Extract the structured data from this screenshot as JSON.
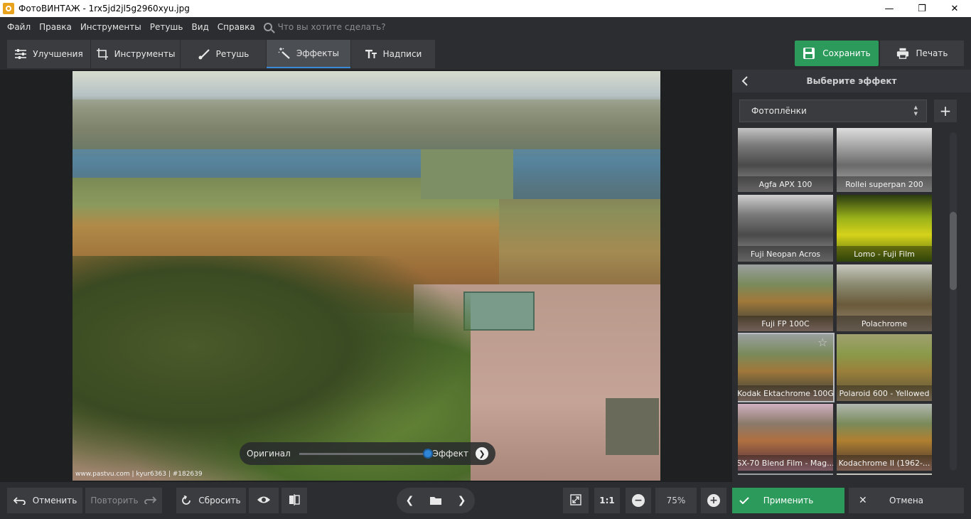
{
  "window": {
    "title": "ФотоВИНТАЖ - 1rx5jd2jl5g2960xyu.jpg",
    "minimize": "—",
    "maximize": "❐",
    "close": "✕"
  },
  "menu": {
    "items": [
      "Файл",
      "Правка",
      "Инструменты",
      "Ретушь",
      "Вид",
      "Справка"
    ],
    "search_placeholder": "Что вы хотите сделать?"
  },
  "tabs": [
    {
      "label": "Улучшения",
      "icon": "sliders-icon"
    },
    {
      "label": "Инструменты",
      "icon": "crop-icon"
    },
    {
      "label": "Ретушь",
      "icon": "brush-icon"
    },
    {
      "label": "Эффекты",
      "icon": "magic-wand-icon",
      "active": true
    },
    {
      "label": "Надписи",
      "icon": "text-icon"
    }
  ],
  "toolbar": {
    "save_label": "Сохранить",
    "print_label": "Печать"
  },
  "photo": {
    "credit": "www.pastvu.com | kyur6363 | #182639"
  },
  "compare": {
    "original_label": "Оригинал",
    "effect_label": "Эффект",
    "arrow": "❯"
  },
  "panel": {
    "title": "Выберите эффект",
    "category": "Фотоплёнки",
    "add": "+",
    "effects": [
      {
        "label": "Agfa APX 100",
        "style": "bw"
      },
      {
        "label": "Rollei superpan 200",
        "style": "bw-light"
      },
      {
        "label": "Fuji Neopan Acros",
        "style": "bw"
      },
      {
        "label": "Lomo - Fuji Film",
        "style": "lomo"
      },
      {
        "label": "Fuji FP 100C",
        "style": "warm"
      },
      {
        "label": "Polachrome",
        "style": "muted"
      },
      {
        "label": "Kodak Ektachrome 100G",
        "style": "warm",
        "selected": true
      },
      {
        "label": "Polaroid 600 - Yellowed",
        "style": "yellow"
      },
      {
        "label": "SX-70 Blend Film - Mag...",
        "style": "magenta"
      },
      {
        "label": "Kodachrome II (1962-...",
        "style": "kodachrome"
      },
      {
        "label": "",
        "style": "warm"
      },
      {
        "label": "",
        "style": "muted"
      }
    ]
  },
  "bottom": {
    "undo_label": "Отменить",
    "redo_label": "Повторить",
    "reset_label": "Сбросить",
    "prev": "❮",
    "next": "❯",
    "ratio_label": "1:1",
    "zoom_value": "75%",
    "zoom_out": "−",
    "zoom_in": "+",
    "apply_label": "Применить",
    "cancel_label": "Отмена"
  },
  "colors": {
    "accent_green": "#2b9a5a",
    "accent_blue": "#2f86d6",
    "panel_bg": "#2b2d30"
  }
}
